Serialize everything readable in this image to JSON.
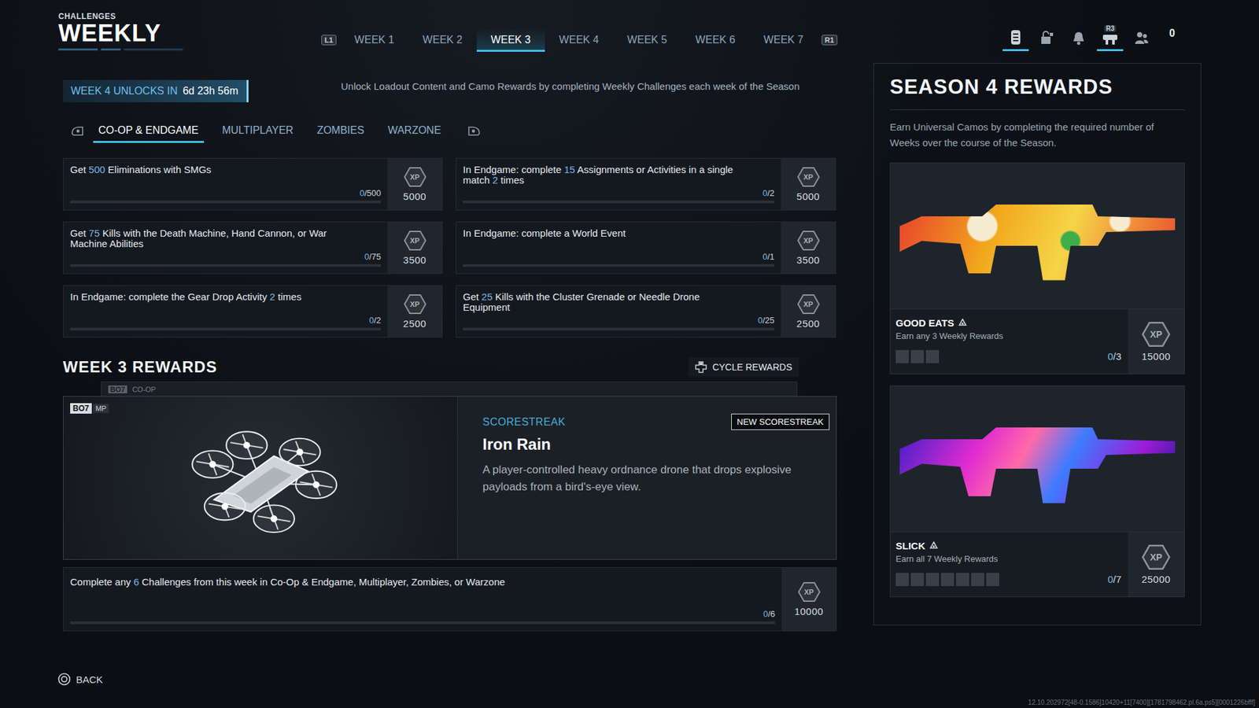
{
  "header": {
    "section": "CHALLENGES",
    "title": "WEEKLY"
  },
  "week_nav": {
    "prev": "L1",
    "next": "R1"
  },
  "weeks": [
    {
      "label": "WEEK 1",
      "selected": false
    },
    {
      "label": "WEEK 2",
      "selected": false
    },
    {
      "label": "WEEK 3",
      "selected": true
    },
    {
      "label": "WEEK 4",
      "selected": false
    },
    {
      "label": "WEEK 5",
      "selected": false
    },
    {
      "label": "WEEK 6",
      "selected": false
    },
    {
      "label": "WEEK 7",
      "selected": false
    }
  ],
  "top_icons": [
    {
      "selected": true
    },
    {
      "selected": false
    },
    {
      "selected": false
    },
    {
      "selected": true,
      "button_hint": "R3"
    },
    {
      "selected": false
    }
  ],
  "currency": "0",
  "unlock": {
    "label": "WEEK 4 UNLOCKS IN",
    "time": "6d 23h 56m"
  },
  "intro": "Unlock Loadout Content and Camo Rewards by completing Weekly Challenges each week of the Season",
  "modes": [
    {
      "label": "CO-OP & ENDGAME",
      "selected": true
    },
    {
      "label": "MULTIPLAYER",
      "selected": false
    },
    {
      "label": "ZOMBIES",
      "selected": false
    },
    {
      "label": "WARZONE",
      "selected": false
    }
  ],
  "xp_icon_text": "XP",
  "challenges": [
    {
      "text": "Get 500 Eliminations with SMGs",
      "progress": "0/500",
      "level": 0,
      "xp": "5000"
    },
    {
      "text": "In Endgame: complete 15 Assignments or Activities in a single match 2 times",
      "progress": "0/2",
      "level": 0,
      "xp": "5000"
    },
    {
      "text": "Get 75 Kills with the Death Machine, Hand Cannon, or War Machine Abilities",
      "progress": "0/75",
      "level": 0,
      "xp": "3500"
    },
    {
      "text": "In Endgame: complete a World Event",
      "progress": "0/1",
      "level": 0,
      "xp": "3500"
    },
    {
      "text": "In Endgame: complete the Gear Drop Activity 2 times",
      "progress": "0/2",
      "level": 0,
      "xp": "2500"
    },
    {
      "text": "Get 25 Kills with the Cluster Grenade or Needle Drone Equipment",
      "progress": "0/25",
      "level": 0,
      "xp": "2500"
    }
  ],
  "rewards": {
    "title": "WEEK 3 REWARDS",
    "cycle": "CYCLE REWARDS",
    "peek": {
      "badge": "BO7",
      "label": "CO-OP"
    },
    "card": {
      "badge": "BO7",
      "mode": "MP",
      "kind": "SCORESTREAK",
      "tag": "NEW SCORESTREAK",
      "name": "Iron Rain",
      "description": "A player-controlled heavy ordnance drone that drops explosive payloads from a bird's-eye view."
    },
    "meta": {
      "text": "Complete any 6 Challenges from this week in Co-Op & Endgame, Multiplayer, Zombies, or Warzone",
      "progress": "0/6",
      "level": 0,
      "xp": "10000"
    }
  },
  "season": {
    "title": "SEASON 4 REWARDS",
    "description": "Earn Universal Camos by completing the required number of Weeks over the course of the Season.",
    "camos": [
      {
        "name": "GOOD EATS",
        "requirement": "Earn any 3 Weekly Rewards",
        "progress": "0/3",
        "steps": [
          false,
          false,
          false
        ],
        "xp": "15000"
      },
      {
        "name": "SLICK",
        "requirement": "Earn all 7 Weekly Rewards",
        "progress": "0/7",
        "steps": [
          false,
          false,
          false,
          false,
          false,
          false,
          false
        ],
        "xp": "25000"
      }
    ]
  },
  "back": "BACK",
  "build": "12.10.202972[48-0.1586]10420+11[7400][1781798462.pl.6a.ps5][0001226bfff]"
}
